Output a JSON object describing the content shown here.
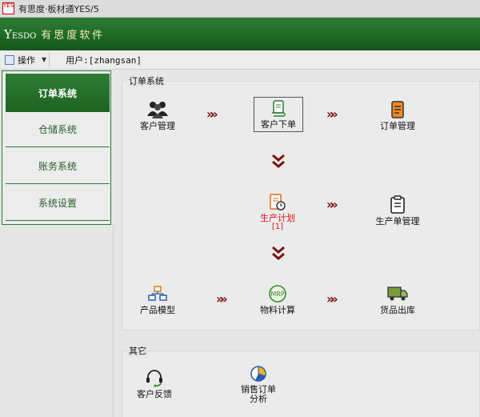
{
  "window": {
    "title": "有思度·板材通YES/5",
    "app_icon_text": "YES"
  },
  "brand": {
    "logo_big": "Y",
    "logo_small": "ESDO",
    "name": "有思度软件"
  },
  "toolbar": {
    "ops_label": "操作",
    "user_label": "用户:[zhangsan]"
  },
  "sidebar": {
    "items": [
      {
        "label": "订单系统",
        "active": true
      },
      {
        "label": "仓储系统",
        "active": false
      },
      {
        "label": "账务系统",
        "active": false
      },
      {
        "label": "系统设置",
        "active": false
      }
    ]
  },
  "order_group": {
    "title": "订单系统",
    "nodes": {
      "customer_mgmt": "客户管理",
      "customer_order": "客户下单",
      "order_mgmt": "订单管理",
      "prod_plan": "生产计划",
      "prod_plan_count": "[1]",
      "prod_order_mgmt": "生产单管理",
      "product_model": "产品模型",
      "material_calc": "物料计算",
      "goods_out": "货品出库"
    },
    "arrow_color": "#7a1212"
  },
  "other_group": {
    "title": "其它",
    "nodes": {
      "customer_feedback": "客户反馈",
      "sales_analysis_line1": "销售订单",
      "sales_analysis_line2": "分析"
    }
  },
  "colors": {
    "brand_green": "#1f6a26",
    "accent_red": "#e01414",
    "arrow": "#7a1212"
  },
  "icons": {
    "customer_mgmt": "people-group-icon",
    "customer_order": "scroll-icon",
    "order_mgmt": "document-orange-icon",
    "prod_plan": "doc-clock-icon",
    "prod_order_mgmt": "clipboard-icon",
    "product_model": "hierarchy-icon",
    "material_calc": "mrp-icon",
    "goods_out": "truck-icon",
    "customer_feedback": "headset-icon",
    "sales_analysis": "pie-chart-icon"
  }
}
